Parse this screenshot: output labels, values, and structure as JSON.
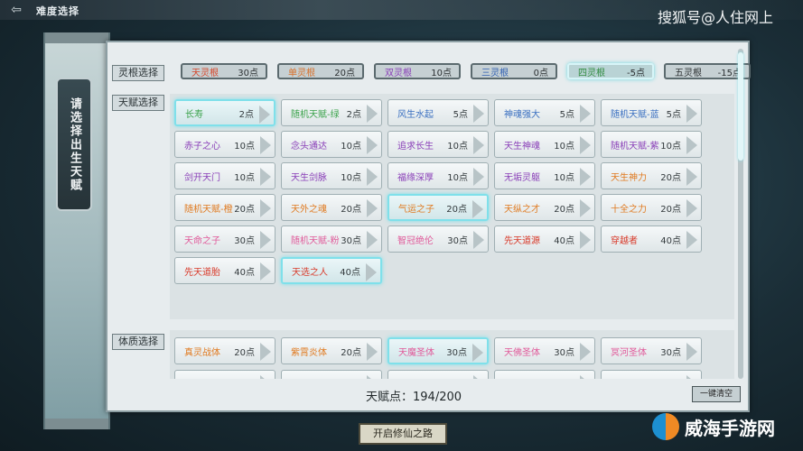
{
  "header": {
    "back_symbol": "⇦",
    "title": "难度选择",
    "watermark": "搜狐号@人住网上"
  },
  "side_label": "请选择出生天赋",
  "sections": {
    "root": "灵根选择",
    "talent": "天赋选择",
    "physique": "体质选择"
  },
  "roots": [
    {
      "name": "天灵根",
      "cost": "30点",
      "color": "#d6462a",
      "selected": false
    },
    {
      "name": "单灵根",
      "cost": "20点",
      "color": "#d8702a",
      "selected": false
    },
    {
      "name": "双灵根",
      "cost": "10点",
      "color": "#8a3fb8",
      "selected": false
    },
    {
      "name": "三灵根",
      "cost": "0点",
      "color": "#2f5fb2",
      "selected": false
    },
    {
      "name": "四灵根",
      "cost": "-5点",
      "color": "#2f8b3f",
      "selected": true
    },
    {
      "name": "五灵根",
      "cost": "-15点",
      "color": "#2b2f31",
      "selected": false
    }
  ],
  "talents": [
    {
      "name": "长寿",
      "cost": "2点",
      "color": "#3aa24a",
      "selected": true
    },
    {
      "name": "随机天赋-绿",
      "cost": "2点",
      "color": "#3aa24a",
      "selected": false
    },
    {
      "name": "风生水起",
      "cost": "5点",
      "color": "#3a6fc0",
      "selected": false
    },
    {
      "name": "神魂强大",
      "cost": "5点",
      "color": "#3a6fc0",
      "selected": false
    },
    {
      "name": "随机天赋-蓝",
      "cost": "5点",
      "color": "#3a6fc0",
      "selected": false
    },
    {
      "name": "赤子之心",
      "cost": "10点",
      "color": "#8a3fb8",
      "selected": false
    },
    {
      "name": "念头通达",
      "cost": "10点",
      "color": "#8a3fb8",
      "selected": false
    },
    {
      "name": "追求长生",
      "cost": "10点",
      "color": "#8a3fb8",
      "selected": false
    },
    {
      "name": "天生神魂",
      "cost": "10点",
      "color": "#8a3fb8",
      "selected": false
    },
    {
      "name": "随机天赋-紫",
      "cost": "10点",
      "color": "#8a3fb8",
      "selected": false
    },
    {
      "name": "剑开天门",
      "cost": "10点",
      "color": "#8a3fb8",
      "selected": false
    },
    {
      "name": "天生剑脉",
      "cost": "10点",
      "color": "#8a3fb8",
      "selected": false
    },
    {
      "name": "福缘深厚",
      "cost": "10点",
      "color": "#8a3fb8",
      "selected": false
    },
    {
      "name": "无垢灵躯",
      "cost": "10点",
      "color": "#8a3fb8",
      "selected": false
    },
    {
      "name": "天生神力",
      "cost": "20点",
      "color": "#e07a20",
      "selected": false
    },
    {
      "name": "随机天赋-橙",
      "cost": "20点",
      "color": "#e07a20",
      "selected": false
    },
    {
      "name": "天外之魂",
      "cost": "20点",
      "color": "#e07a20",
      "selected": false
    },
    {
      "name": "气运之子",
      "cost": "20点",
      "color": "#e07a20",
      "selected": true
    },
    {
      "name": "天纵之才",
      "cost": "20点",
      "color": "#e07a20",
      "selected": false
    },
    {
      "name": "十全之力",
      "cost": "20点",
      "color": "#e07a20",
      "selected": false
    },
    {
      "name": "天命之子",
      "cost": "30点",
      "color": "#e05a9a",
      "selected": false
    },
    {
      "name": "随机天赋-粉",
      "cost": "30点",
      "color": "#e05a9a",
      "selected": false
    },
    {
      "name": "智冠绝伦",
      "cost": "30点",
      "color": "#e05a9a",
      "selected": false
    },
    {
      "name": "先天道源",
      "cost": "40点",
      "color": "#d83a2a",
      "selected": false
    },
    {
      "name": "穿越者",
      "cost": "40点",
      "color": "#d83a2a",
      "selected": false
    },
    {
      "name": "先天道胎",
      "cost": "40点",
      "color": "#d83a2a",
      "selected": false
    },
    {
      "name": "天选之人",
      "cost": "40点",
      "color": "#d83a2a",
      "selected": true
    }
  ],
  "physiques": [
    {
      "name": "真灵战体",
      "cost": "20点",
      "color": "#e07a20",
      "selected": false
    },
    {
      "name": "紫霄炎体",
      "cost": "20点",
      "color": "#e07a20",
      "selected": false
    },
    {
      "name": "天魔圣体",
      "cost": "30点",
      "color": "#e05a9a",
      "selected": true
    },
    {
      "name": "天佛圣体",
      "cost": "30点",
      "color": "#e05a9a",
      "selected": false
    },
    {
      "name": "冥河圣体",
      "cost": "30点",
      "color": "#e05a9a",
      "selected": false
    }
  ],
  "footer": {
    "points": "天赋点：194/200",
    "clear": "一键清空",
    "start": "开启修仙之路"
  },
  "brand": "威海手游网"
}
